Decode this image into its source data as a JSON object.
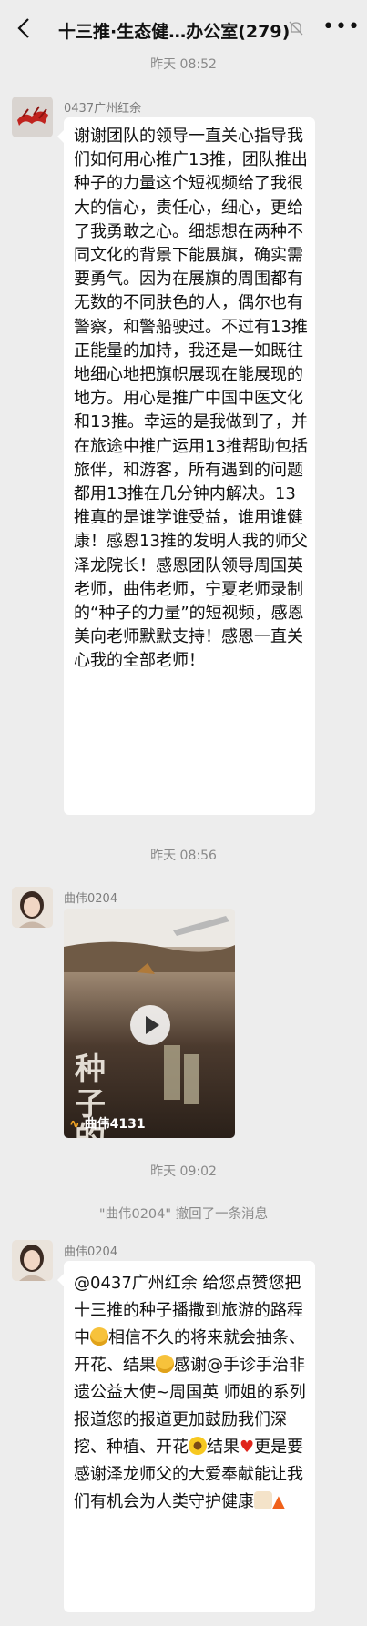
{
  "header": {
    "title": "十三推·生态健…办公室(279)",
    "back_icon": "chevron-left-icon",
    "mute_icon": "bell-muted-icon",
    "more_icon": "more-dots-icon"
  },
  "messages": [
    {
      "time": "昨天 08:52",
      "sender": "0437广州红余",
      "text": "谢谢团队的领导一直关心指导我们如何用心推广13推，团队推出种子的力量这个短视频给了我很大的信心，责任心，细心，更给了我勇敢之心。细想想在两种不同文化的背景下能展旗，确实需要勇气。因为在展旗的周围都有无数的不同肤色的人，偶尔也有警察，和警船驶过。不过有13推正能量的加持，我还是一如既往地细心地把旗帜展现在能展现的地方。用心是推广中国中医文化和13推。幸运的是我做到了，并在旅途中推广运用13推帮助包括旅伴，和游客，所有遇到的问题都用13推在几分钟内解决。13推真的是谁学谁受益，谁用谁健康！感恩13推的发明人我的师父泽龙院长！感恩团队领导周国英老师，曲伟老师，宁夏老师录制的“种子的力量”的短视频，感恩美向老师默默支持！感恩一直关心我的全部老师！"
    },
    {
      "time": "昨天 08:56",
      "sender": "曲伟0204",
      "video_overlay_title": "种子的",
      "video_caption": "曲伟4131"
    },
    {
      "time": "昨天 09:02",
      "recall": "\"曲伟0204\" 撤回了一条消息",
      "sender": "曲伟0204",
      "text_parts": [
        "@0437广州红余 给您点赞您把十三推的种子播撒到旅游的路程中",
        "相信不久的将来就会抽条、开花、结果",
        "感谢@手诊手治非遗公益大使~周国英 师姐的系列报道您的报道更加鼓励我们深挖、种植、开花",
        "结果",
        "更是要感谢泽龙师父的大爱奉献能让我们有机会为人类守护健康"
      ]
    }
  ],
  "colors": {
    "background": "#ededed",
    "bubble": "#ffffff",
    "meta_text": "#8a8a8a"
  }
}
